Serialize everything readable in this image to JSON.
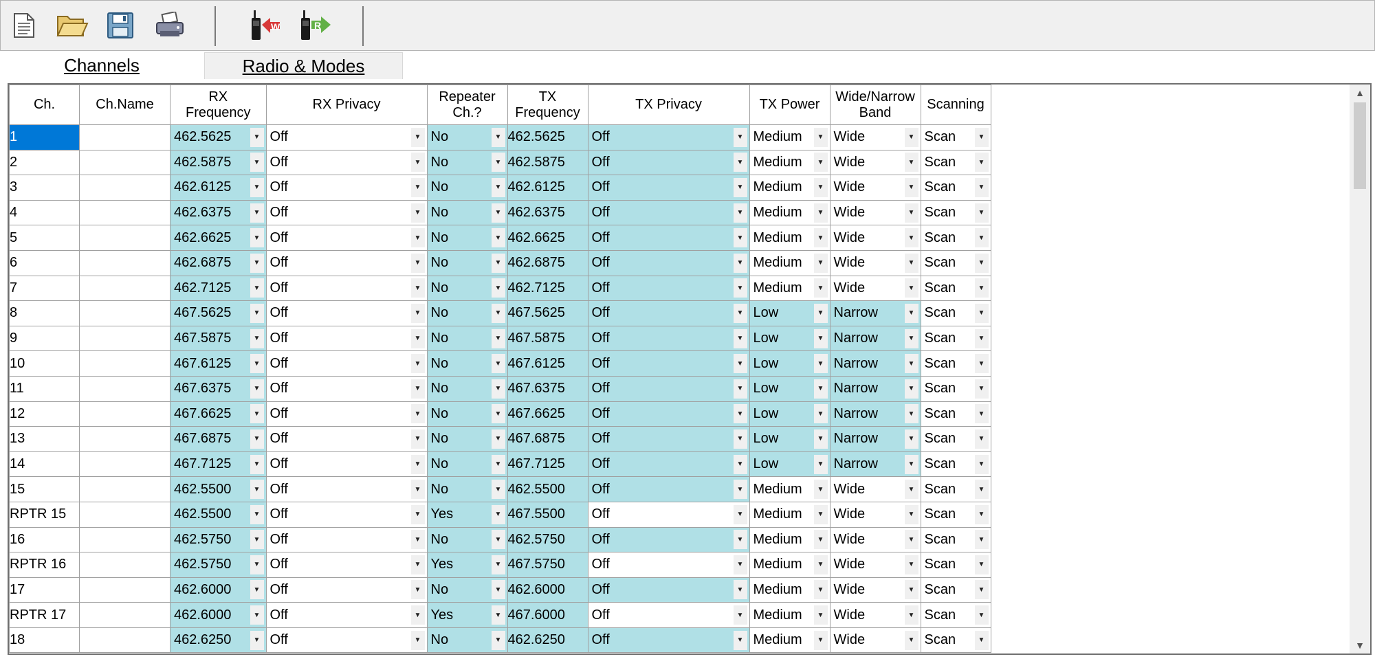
{
  "tabs": {
    "channels": "Channels",
    "radio_modes": "Radio & Modes"
  },
  "toolbar": {
    "icons": [
      "new-file-icon",
      "open-folder-icon",
      "save-icon",
      "print-icon",
      "write-radio-icon",
      "read-radio-icon"
    ],
    "write_badge": "W",
    "read_badge": "R"
  },
  "colors": {
    "highlight": "#b0e0e6",
    "selection": "#0078d7"
  },
  "headers": {
    "ch": "Ch.",
    "ch_name": "Ch.Name",
    "rx_freq": "RX Frequency",
    "rx_privacy": "RX Privacy",
    "repeater": "Repeater Ch.?",
    "tx_freq": "TX Frequency",
    "tx_privacy": "TX Privacy",
    "tx_power": "TX Power",
    "band": "Wide/Narrow Band",
    "scanning": "Scanning"
  },
  "rows": [
    {
      "ch": "1",
      "name": "",
      "rx": "462.5625",
      "rxp": "Off",
      "rep": "No",
      "tx": "462.5625",
      "txp": "Off",
      "pwr": "Medium",
      "band": "Wide",
      "scan": "Scan"
    },
    {
      "ch": "2",
      "name": "",
      "rx": "462.5875",
      "rxp": "Off",
      "rep": "No",
      "tx": "462.5875",
      "txp": "Off",
      "pwr": "Medium",
      "band": "Wide",
      "scan": "Scan"
    },
    {
      "ch": "3",
      "name": "",
      "rx": "462.6125",
      "rxp": "Off",
      "rep": "No",
      "tx": "462.6125",
      "txp": "Off",
      "pwr": "Medium",
      "band": "Wide",
      "scan": "Scan"
    },
    {
      "ch": "4",
      "name": "",
      "rx": "462.6375",
      "rxp": "Off",
      "rep": "No",
      "tx": "462.6375",
      "txp": "Off",
      "pwr": "Medium",
      "band": "Wide",
      "scan": "Scan"
    },
    {
      "ch": "5",
      "name": "",
      "rx": "462.6625",
      "rxp": "Off",
      "rep": "No",
      "tx": "462.6625",
      "txp": "Off",
      "pwr": "Medium",
      "band": "Wide",
      "scan": "Scan"
    },
    {
      "ch": "6",
      "name": "",
      "rx": "462.6875",
      "rxp": "Off",
      "rep": "No",
      "tx": "462.6875",
      "txp": "Off",
      "pwr": "Medium",
      "band": "Wide",
      "scan": "Scan"
    },
    {
      "ch": "7",
      "name": "",
      "rx": "462.7125",
      "rxp": "Off",
      "rep": "No",
      "tx": "462.7125",
      "txp": "Off",
      "pwr": "Medium",
      "band": "Wide",
      "scan": "Scan"
    },
    {
      "ch": "8",
      "name": "",
      "rx": "467.5625",
      "rxp": "Off",
      "rep": "No",
      "tx": "467.5625",
      "txp": "Off",
      "pwr": "Low",
      "band": "Narrow",
      "scan": "Scan"
    },
    {
      "ch": "9",
      "name": "",
      "rx": "467.5875",
      "rxp": "Off",
      "rep": "No",
      "tx": "467.5875",
      "txp": "Off",
      "pwr": "Low",
      "band": "Narrow",
      "scan": "Scan"
    },
    {
      "ch": "10",
      "name": "",
      "rx": "467.6125",
      "rxp": "Off",
      "rep": "No",
      "tx": "467.6125",
      "txp": "Off",
      "pwr": "Low",
      "band": "Narrow",
      "scan": "Scan"
    },
    {
      "ch": "11",
      "name": "",
      "rx": "467.6375",
      "rxp": "Off",
      "rep": "No",
      "tx": "467.6375",
      "txp": "Off",
      "pwr": "Low",
      "band": "Narrow",
      "scan": "Scan"
    },
    {
      "ch": "12",
      "name": "",
      "rx": "467.6625",
      "rxp": "Off",
      "rep": "No",
      "tx": "467.6625",
      "txp": "Off",
      "pwr": "Low",
      "band": "Narrow",
      "scan": "Scan"
    },
    {
      "ch": "13",
      "name": "",
      "rx": "467.6875",
      "rxp": "Off",
      "rep": "No",
      "tx": "467.6875",
      "txp": "Off",
      "pwr": "Low",
      "band": "Narrow",
      "scan": "Scan"
    },
    {
      "ch": "14",
      "name": "",
      "rx": "467.7125",
      "rxp": "Off",
      "rep": "No",
      "tx": "467.7125",
      "txp": "Off",
      "pwr": "Low",
      "band": "Narrow",
      "scan": "Scan"
    },
    {
      "ch": "15",
      "name": "",
      "rx": "462.5500",
      "rxp": "Off",
      "rep": "No",
      "tx": "462.5500",
      "txp": "Off",
      "pwr": "Medium",
      "band": "Wide",
      "scan": "Scan"
    },
    {
      "ch": "RPTR 15",
      "name": "",
      "rx": "462.5500",
      "rxp": "Off",
      "rep": "Yes",
      "tx": "467.5500",
      "txp": "Off",
      "pwr": "Medium",
      "band": "Wide",
      "scan": "Scan"
    },
    {
      "ch": "16",
      "name": "",
      "rx": "462.5750",
      "rxp": "Off",
      "rep": "No",
      "tx": "462.5750",
      "txp": "Off",
      "pwr": "Medium",
      "band": "Wide",
      "scan": "Scan"
    },
    {
      "ch": "RPTR 16",
      "name": "",
      "rx": "462.5750",
      "rxp": "Off",
      "rep": "Yes",
      "tx": "467.5750",
      "txp": "Off",
      "pwr": "Medium",
      "band": "Wide",
      "scan": "Scan"
    },
    {
      "ch": "17",
      "name": "",
      "rx": "462.6000",
      "rxp": "Off",
      "rep": "No",
      "tx": "462.6000",
      "txp": "Off",
      "pwr": "Medium",
      "band": "Wide",
      "scan": "Scan"
    },
    {
      "ch": "RPTR 17",
      "name": "",
      "rx": "462.6000",
      "rxp": "Off",
      "rep": "Yes",
      "tx": "467.6000",
      "txp": "Off",
      "pwr": "Medium",
      "band": "Wide",
      "scan": "Scan"
    },
    {
      "ch": "18",
      "name": "",
      "rx": "462.6250",
      "rxp": "Off",
      "rep": "No",
      "tx": "462.6250",
      "txp": "Off",
      "pwr": "Medium",
      "band": "Wide",
      "scan": "Scan"
    }
  ]
}
